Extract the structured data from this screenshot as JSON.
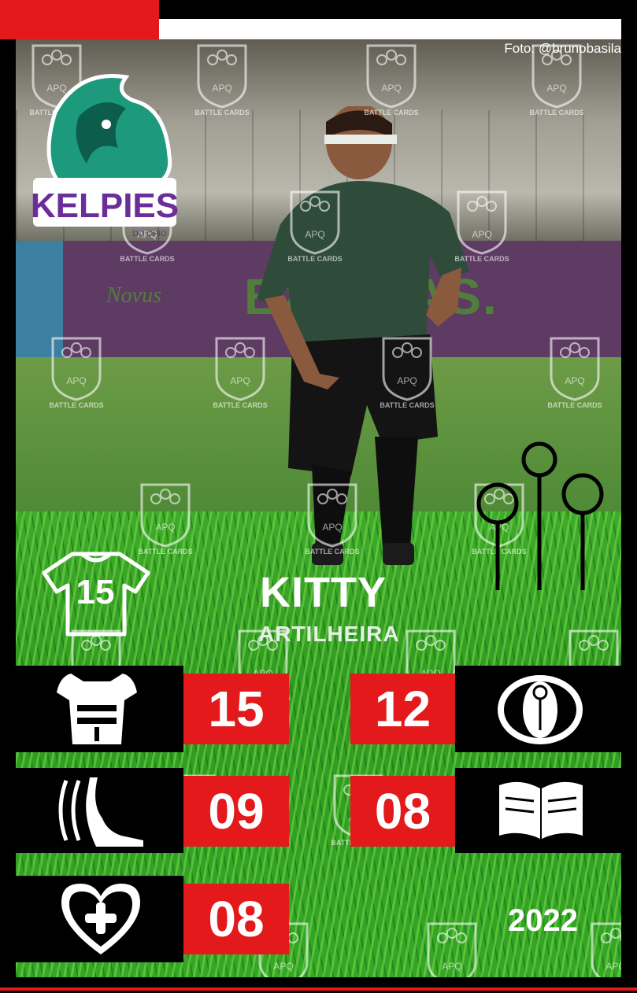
{
  "credit": "Foto: @brunobasila",
  "team": {
    "logo_text": "KELPIES",
    "logo_subtext": "DO OHIO"
  },
  "banner": {
    "brand": "Novus",
    "text": "EX    TIVAS."
  },
  "watermark": {
    "monogram": "APQ",
    "label": "BATTLE CARDS"
  },
  "player": {
    "number": "15",
    "name": "KITTY",
    "position": "ARTILHEIRA"
  },
  "stats": {
    "armor": "15",
    "vision": "12",
    "speed": "09",
    "knowledge": "08",
    "health": "08"
  },
  "year": "2022",
  "colors": {
    "accent_red": "#e3191b",
    "kelpies_teal": "#1d9a7c",
    "kelpies_purple": "#6a2d9a"
  }
}
